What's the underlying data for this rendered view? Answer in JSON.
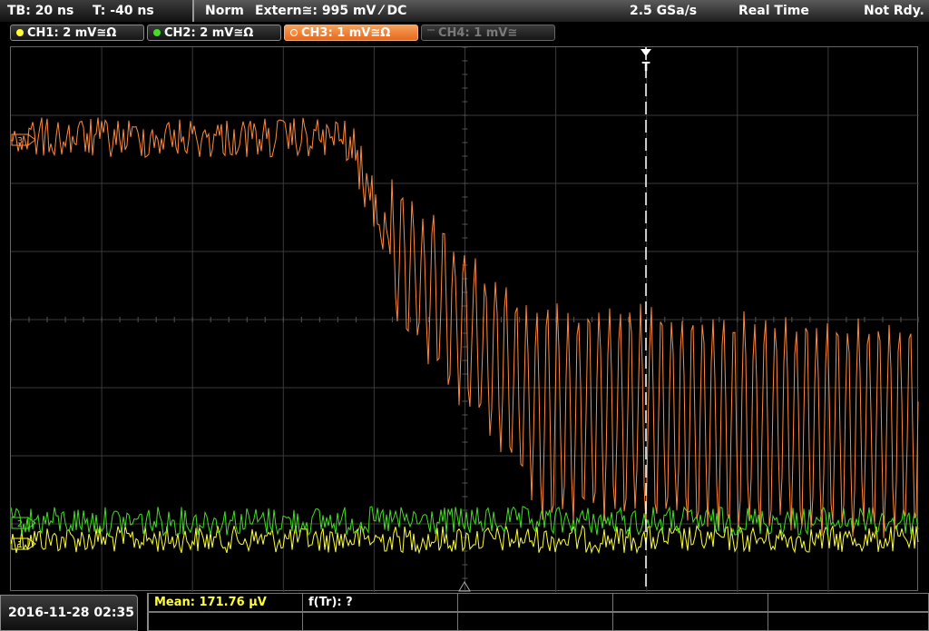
{
  "topbar": {
    "timebase": "TB: 20 ns",
    "trigger_time": "T: -40 ns",
    "trigger_mode": "Norm",
    "trigger_source": "Extern≅: 995 mV ⁄ DC",
    "sample_rate": "2.5 GSa/s",
    "acq_mode": "Real Time",
    "status": "Not Rdy."
  },
  "channels": [
    {
      "label": "CH1: 2 mV≅Ω",
      "color": "#ffff33",
      "state": "on"
    },
    {
      "label": "CH2: 2 mV≅Ω",
      "color": "#44dd22",
      "state": "on"
    },
    {
      "label": "CH3: 1 mV≅Ω",
      "color": "#ff8a3c",
      "state": "active"
    },
    {
      "label": "CH4: 1 mV≅",
      "color": "#777777",
      "state": "off"
    }
  ],
  "markers": {
    "trigger_top": "T",
    "ch3_ref": "3",
    "ch2_ref": "2",
    "ch1_ref": "1"
  },
  "footer": {
    "date": "2016-11-28 02:35",
    "mean_label": "Mean: 171.76 µV",
    "ftr_label": "f(Tr): ?"
  },
  "colors": {
    "ch1": "#ffff33",
    "ch2": "#44dd22",
    "ch3": "#ff8a3c",
    "grid": "#3a3a3a",
    "mean_text": "#ffff33"
  }
}
